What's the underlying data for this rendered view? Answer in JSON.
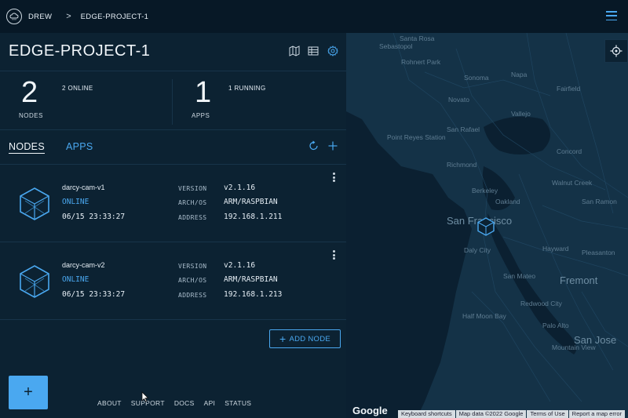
{
  "topbar": {
    "user": "DREW",
    "separator": ">",
    "project": "EDGE-PROJECT-1"
  },
  "project": {
    "title": "EDGE-PROJECT-1"
  },
  "stats": {
    "nodes_count": "2",
    "nodes_label": "NODES",
    "nodes_sub": "2 ONLINE",
    "apps_count": "1",
    "apps_label": "APPS",
    "apps_sub": "1 RUNNING"
  },
  "tabs": {
    "nodes": "NODES",
    "apps": "APPS"
  },
  "nodes": [
    {
      "name": "darcy-cam-v1",
      "status": "ONLINE",
      "timestamp": "06/15 23:33:27",
      "version_label": "VERSION",
      "version": "v2.1.16",
      "arch_label": "ARCH/OS",
      "arch": "ARM/RASPBIAN",
      "address_label": "ADDRESS",
      "address": "192.168.1.211"
    },
    {
      "name": "darcy-cam-v2",
      "status": "ONLINE",
      "timestamp": "06/15 23:33:27",
      "version_label": "VERSION",
      "version": "v2.1.16",
      "arch_label": "ARCH/OS",
      "arch": "ARM/RASPBIAN",
      "address_label": "ADDRESS",
      "address": "192.168.1.213"
    }
  ],
  "add_node": {
    "label": "ADD NODE"
  },
  "footer": {
    "about": "ABOUT",
    "support": "SUPPORT",
    "docs": "DOCS",
    "api": "API",
    "status": "STATUS"
  },
  "map": {
    "labels": {
      "santa_rosa": "Santa Rosa",
      "sebastopol": "Sebastopol",
      "rohnert_park": "Rohnert Park",
      "sonoma": "Sonoma",
      "napa": "Napa",
      "novato": "Novato",
      "vallejo": "Vallejo",
      "fairfield": "Fairfield",
      "san_rafael": "San Rafael",
      "concord": "Concord",
      "point_reyes": "Point Reyes Station",
      "richmond": "Richmond",
      "walnut_creek": "Walnut Creek",
      "berkeley": "Berkeley",
      "oakland": "Oakland",
      "san_francisco": "San Francisco",
      "san_ramon": "San Ramon",
      "daly_city": "Daly City",
      "hayward": "Hayward",
      "pleasanton": "Pleasanton",
      "san_mateo": "San Mateo",
      "fremont": "Fremont",
      "half_moon_bay": "Half Moon Bay",
      "redwood_city": "Redwood City",
      "palo_alto": "Palo Alto",
      "san_jose": "San Jose",
      "mountain_view": "Mountain View"
    },
    "google": "Google",
    "attribution": {
      "shortcuts": "Keyboard shortcuts",
      "data": "Map data ©2022 Google",
      "terms": "Terms of Use",
      "report": "Report a map error"
    }
  },
  "colors": {
    "accent": "#4aa8f0",
    "panel_bg": "#0c2232",
    "topbar_bg": "#071826",
    "map_bg": "#0e2a3d"
  }
}
